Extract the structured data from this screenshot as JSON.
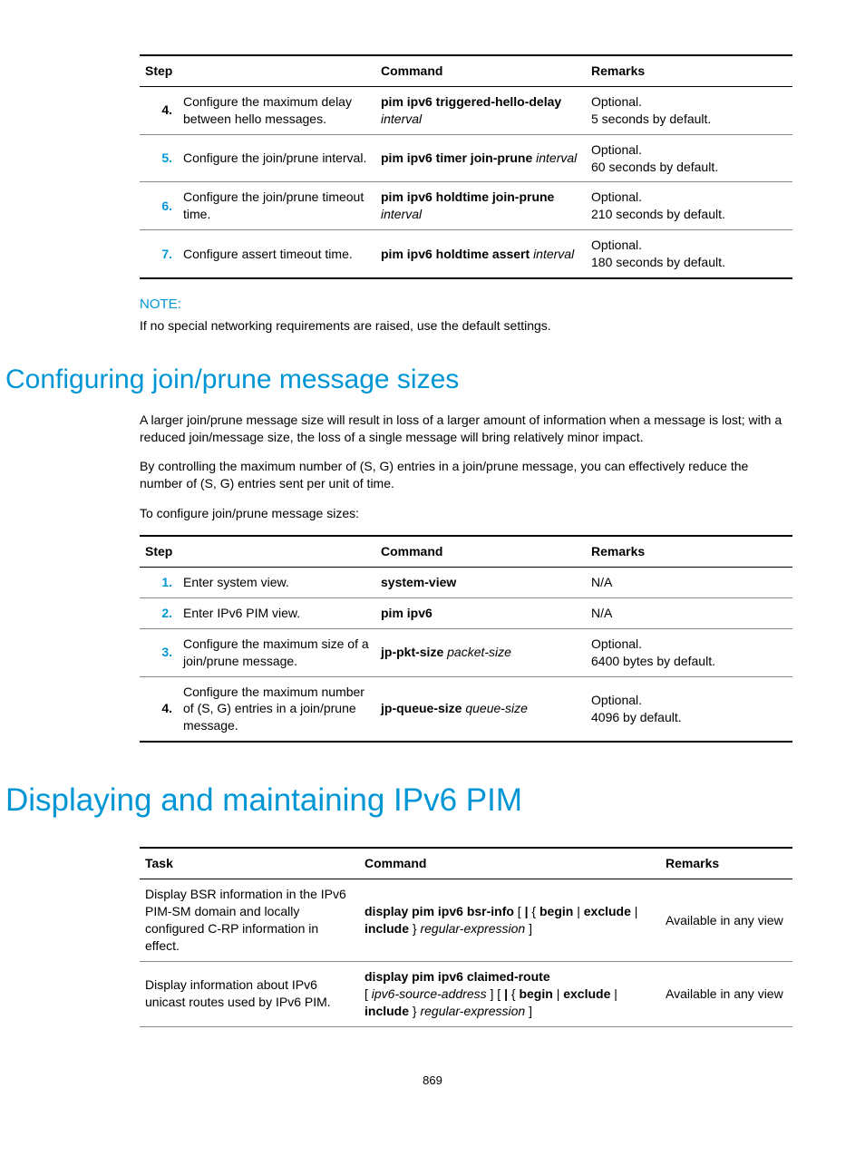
{
  "table1": {
    "headers": {
      "step": "Step",
      "command": "Command",
      "remarks": "Remarks"
    },
    "rows": [
      {
        "num": "4.",
        "numColor": "black",
        "desc": "Configure the maximum delay between hello messages.",
        "cmdBold": "pim ipv6 triggered-hello-delay",
        "cmdItal": "interval",
        "rem1": "Optional.",
        "rem2": "5 seconds by default."
      },
      {
        "num": "5.",
        "numColor": "blue",
        "desc": "Configure the join/prune interval.",
        "cmdBold": "pim ipv6 timer join-prune",
        "cmdItal": "interval",
        "rem1": "Optional.",
        "rem2": "60 seconds by default."
      },
      {
        "num": "6.",
        "numColor": "blue",
        "desc": "Configure the join/prune timeout time.",
        "cmdBold": "pim ipv6 holdtime join-prune",
        "cmdItal": "interval",
        "rem1": "Optional.",
        "rem2": "210 seconds by default."
      },
      {
        "num": "7.",
        "numColor": "blue",
        "desc": "Configure assert timeout time.",
        "cmdBold": "pim ipv6 holdtime assert",
        "cmdItal": "interval",
        "rem1": "Optional.",
        "rem2": "180 seconds by default."
      }
    ]
  },
  "note": {
    "label": "NOTE:",
    "body": "If no special networking requirements are raised, use the default settings."
  },
  "section1": {
    "title": "Configuring join/prune message sizes",
    "p1": "A larger join/prune message size will result in loss of a larger amount of information when a message is lost; with a reduced join/message size, the loss of a single message will bring relatively minor impact.",
    "p2": "By controlling the maximum number of (S, G) entries in a join/prune message, you can effectively reduce the number of (S, G) entries sent per unit of time.",
    "p3": "To configure join/prune message sizes:"
  },
  "table2": {
    "headers": {
      "step": "Step",
      "command": "Command",
      "remarks": "Remarks"
    },
    "rows": [
      {
        "num": "1.",
        "numColor": "blue",
        "desc": "Enter system view.",
        "cmdBold": "system-view",
        "cmdItal": "",
        "rem1": "N/A",
        "rem2": ""
      },
      {
        "num": "2.",
        "numColor": "blue",
        "desc": "Enter IPv6 PIM view.",
        "cmdBold": "pim ipv6",
        "cmdItal": "",
        "rem1": "N/A",
        "rem2": ""
      },
      {
        "num": "3.",
        "numColor": "blue",
        "desc": "Configure the maximum size of a join/prune message.",
        "cmdBold": "jp-pkt-size",
        "cmdItal": "packet-size",
        "rem1": "Optional.",
        "rem2": "6400 bytes by default."
      },
      {
        "num": "4.",
        "numColor": "black",
        "desc": "Configure the maximum number of (S, G) entries in a join/prune message.",
        "cmdBold": "jp-queue-size",
        "cmdItal": "queue-size",
        "rem1": "Optional.",
        "rem2": "4096 by default."
      }
    ]
  },
  "section2": {
    "title": "Displaying and maintaining IPv6 PIM"
  },
  "table3": {
    "headers": {
      "task": "Task",
      "command": "Command",
      "remarks": "Remarks"
    },
    "rows": [
      {
        "task": "Display BSR information in the IPv6 PIM-SM domain and locally configured C-RP information in effect.",
        "cmd_b1": "display pim ipv6 bsr-info",
        "cmd_t1": " [ ",
        "cmd_b2": "|",
        "cmd_t2": " { ",
        "cmd_b3": "begin",
        "cmd_t3": " | ",
        "cmd_b4": "exclude",
        "cmd_t4": " | ",
        "cmd_b5": "include",
        "cmd_t5": " } ",
        "cmd_i1": "regular-expression",
        "cmd_t6": " ]",
        "rem": "Available in any view"
      },
      {
        "task": "Display information about IPv6 unicast routes used by IPv6 PIM.",
        "pre_b1": "display pim ipv6 claimed-route",
        "cmd_t0": "[ ",
        "cmd_i0": "ipv6-source-address",
        "cmd_t0b": " ] [ ",
        "cmd_b2": "|",
        "cmd_t2": " { ",
        "cmd_b3": "begin",
        "cmd_t3": " | ",
        "cmd_b4": "exclude",
        "cmd_t4": " | ",
        "cmd_b5": "include",
        "cmd_t5": " } ",
        "cmd_i1": "regular-expression",
        "cmd_t6": " ]",
        "rem": "Available in any view"
      }
    ]
  },
  "pageNumber": "869"
}
